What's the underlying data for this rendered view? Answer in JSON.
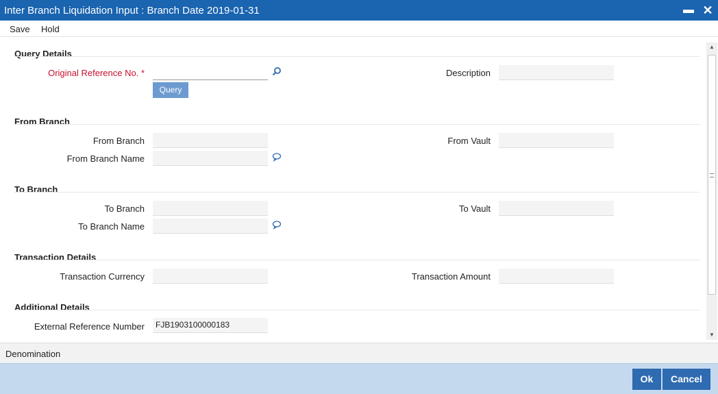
{
  "window": {
    "title": "Inter Branch Liquidation Input : Branch Date 2019-01-31",
    "minimize_icon": "minimize-icon",
    "close_icon": "close-icon"
  },
  "menu": {
    "save": "Save",
    "hold": "Hold"
  },
  "query_details": {
    "title": "Query Details",
    "original_reference_label": "Original Reference No.",
    "required_mark": "*",
    "original_reference_value": "",
    "description_label": "Description",
    "description_value": "",
    "query_button": "Query",
    "search_icon": "search-icon"
  },
  "from_branch": {
    "title": "From Branch",
    "branch_label": "From Branch",
    "branch_value": "",
    "vault_label": "From Vault",
    "vault_value": "",
    "name_label": "From Branch Name",
    "name_value": "",
    "comment_icon": "comment-icon"
  },
  "to_branch": {
    "title": "To Branch",
    "branch_label": "To Branch",
    "branch_value": "",
    "vault_label": "To Vault",
    "vault_value": "",
    "name_label": "To Branch Name",
    "name_value": "",
    "comment_icon": "comment-icon"
  },
  "transaction_details": {
    "title": "Transaction Details",
    "currency_label": "Transaction Currency",
    "currency_value": "",
    "amount_label": "Transaction Amount",
    "amount_value": ""
  },
  "additional_details": {
    "title": "Additional Details",
    "external_ref_label": "External Reference Number",
    "external_ref_value": "FJB1903100000183"
  },
  "tabs": {
    "denomination": "Denomination"
  },
  "footer": {
    "ok": "Ok",
    "cancel": "Cancel"
  },
  "colors": {
    "titlebar": "#1a64b0",
    "required_label": "#c8102e",
    "query_button": "#6d9bd1",
    "footer_bg": "#c5d9ee",
    "footer_button": "#2e6bb0"
  }
}
